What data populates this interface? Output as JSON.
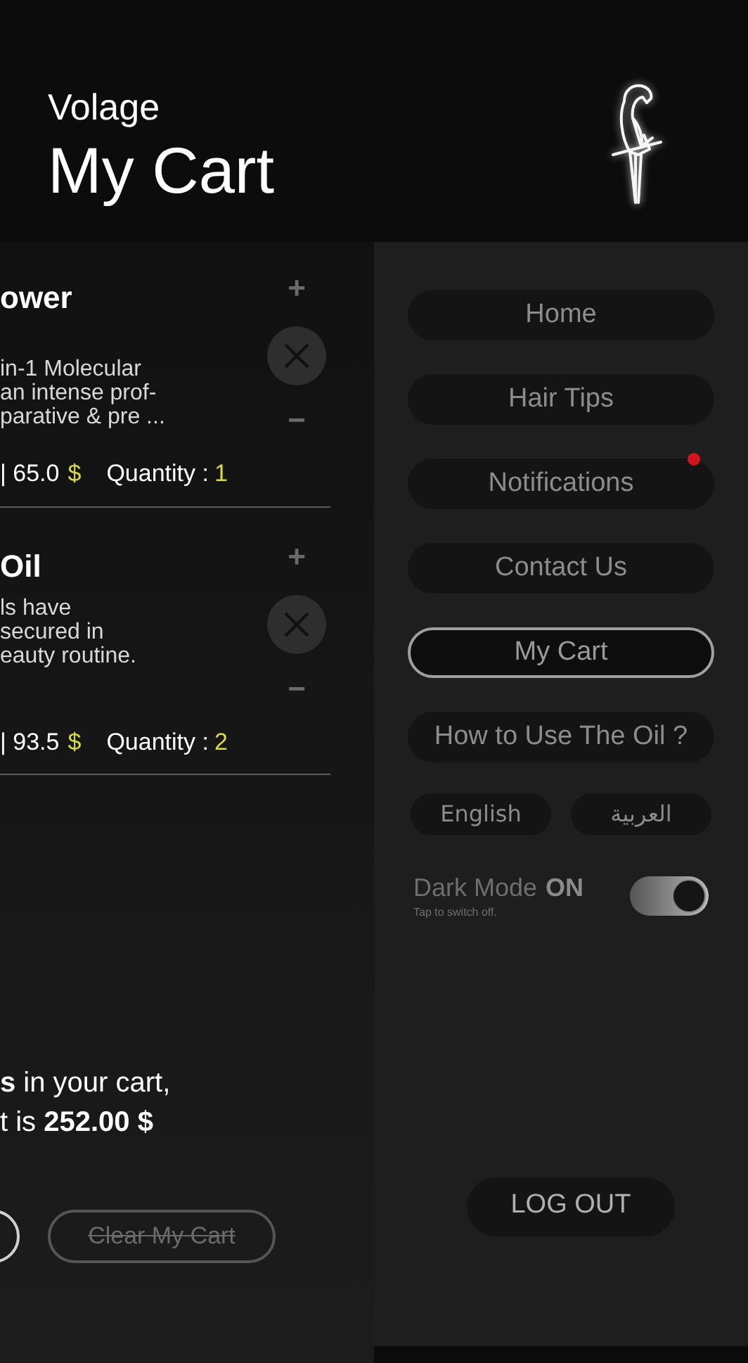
{
  "header": {
    "brand": "Volage",
    "title": "My Cart"
  },
  "cart": {
    "items": [
      {
        "name": "ower",
        "description": "in-1 Molecular\nan intense prof-\nparative & pre ...",
        "price": "| 65.0",
        "currency": "$",
        "quantity_label": "Quantity :",
        "quantity": "1",
        "increase": "+",
        "decrease": "−"
      },
      {
        "name": "Oil",
        "description": "ls have\nsecured in\neauty routine.",
        "price": "| 93.5",
        "currency": "$",
        "quantity_label": "Quantity :",
        "quantity": "2",
        "increase": "+",
        "decrease": "−"
      }
    ],
    "summary": [
      "**s** in your cart,",
      "t is **252.00 $**"
    ],
    "clear_button": {
      "label": "Clear My Cart",
      "disabled": true
    }
  },
  "menu": {
    "items": [
      {
        "label": "Home",
        "selected": false,
        "has_notification": false
      },
      {
        "label": "Hair Tips",
        "selected": false,
        "has_notification": false
      },
      {
        "label": "Notifications",
        "selected": false,
        "has_notification": true
      },
      {
        "label": "Contact Us",
        "selected": false,
        "has_notification": false
      },
      {
        "label": "My Cart",
        "selected": true,
        "has_notification": false
      },
      {
        "label": "How to Use The Oil ?",
        "selected": false,
        "has_notification": false
      }
    ],
    "languages": [
      {
        "label": "English"
      },
      {
        "label": "العربية"
      }
    ],
    "dark_mode": {
      "label": "Dark Mode",
      "state": "ON",
      "hint": "Tap to switch off.",
      "on": true
    },
    "logout": "LOG OUT"
  }
}
